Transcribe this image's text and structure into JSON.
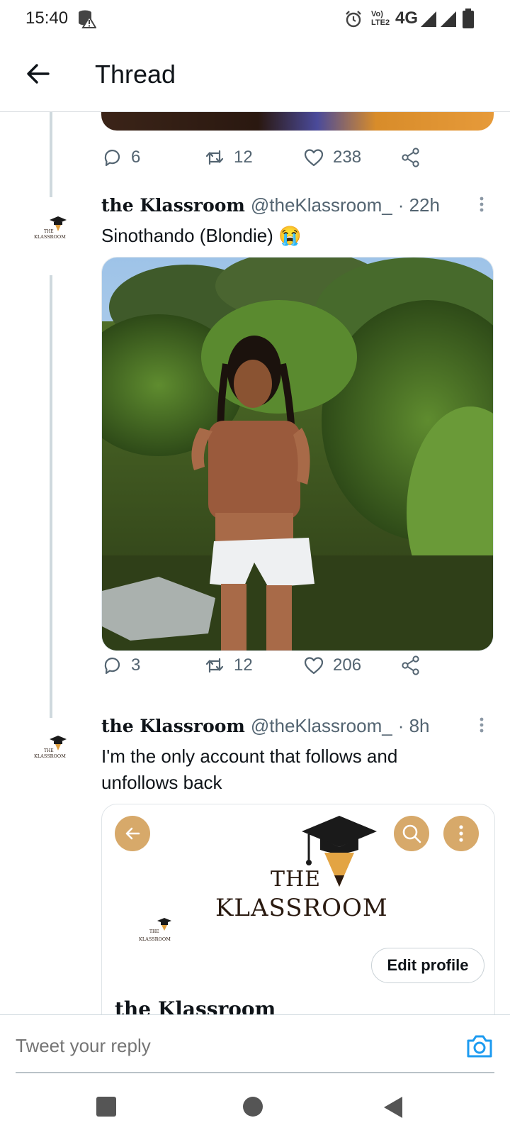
{
  "status_bar": {
    "time": "15:40",
    "network": "4G",
    "volte": "Vo) LTE2",
    "icons": [
      "database-warning-icon",
      "alarm-icon",
      "signal-icon",
      "battery-icon"
    ]
  },
  "header": {
    "title": "Thread",
    "back_icon": "arrow-left-icon"
  },
  "tweets": [
    {
      "stats": {
        "replies": "6",
        "retweets": "12",
        "likes": "238"
      }
    },
    {
      "name": "the Klassroom",
      "handle": "@theKlassroom_",
      "time": "· 22h",
      "text": "Sinothando (Blondie) 😭",
      "stats": {
        "replies": "3",
        "retweets": "12",
        "likes": "206"
      }
    },
    {
      "name": "the Klassroom",
      "handle": "@theKlassroom_",
      "time": "· 8h",
      "text": "I'm the only account that follows and unfollows back"
    }
  ],
  "avatar_logo": {
    "line1": "THE",
    "line2": "KLASSROOM"
  },
  "embedded_card": {
    "brand_the": "THE",
    "brand_name": "KLASSROOM",
    "edit_profile_label": "Edit profile",
    "profile_name": "the Klassroom",
    "mini_logo_line1": "THE",
    "mini_logo_line2": "KLASSROOM"
  },
  "reply": {
    "placeholder": "Tweet your reply",
    "camera_icon": "camera-icon"
  },
  "colors": {
    "icon_gray": "#536471",
    "accent_blue": "#1d9bf0",
    "card_tan": "#d7a96a",
    "thread_line": "#cfd9de"
  },
  "nav": {
    "buttons": [
      "recents-button",
      "home-button",
      "back-button"
    ]
  }
}
